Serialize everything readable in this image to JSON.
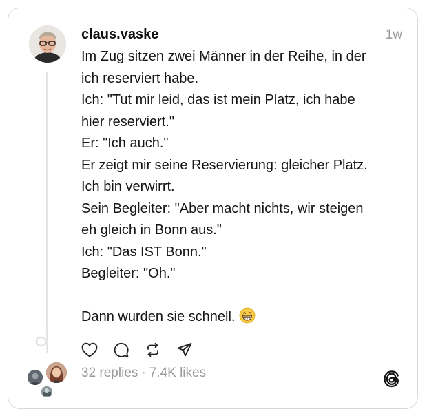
{
  "post": {
    "username": "claus.vaske",
    "time": "1w",
    "lines": [
      "Im Zug sitzen zwei Männer in der Reihe, in der",
      "ich reserviert habe.",
      "Ich: \"Tut mir leid, das ist mein Platz, ich habe",
      "hier reserviert.\"",
      "Er: \"Ich auch.\"",
      "Er zeigt mir seine Reservierung: gleicher Platz.",
      "Ich bin verwirrt.",
      "Sein Begleiter: \"Aber macht nichts, wir steigen",
      "eh gleich in Bonn aus.\"",
      "Ich: \"Das IST Bonn.\"",
      "Begleiter: \"Oh.\"",
      "",
      "Dann wurden sie schnell."
    ],
    "end_emoji": "grinning-face-with-smiling-eyes"
  },
  "actions": {
    "like": "heart-icon",
    "reply": "comment-icon",
    "repost": "repost-icon",
    "share": "share-icon"
  },
  "stats": {
    "replies": "32 replies",
    "separator": "·",
    "likes": "7.4K likes"
  },
  "brand": {
    "logo": "threads-logo-icon"
  },
  "colors": {
    "text": "#151515",
    "muted": "#9a9a9a",
    "border": "#d9d9d9",
    "thread_line": "#e3e3e3"
  }
}
